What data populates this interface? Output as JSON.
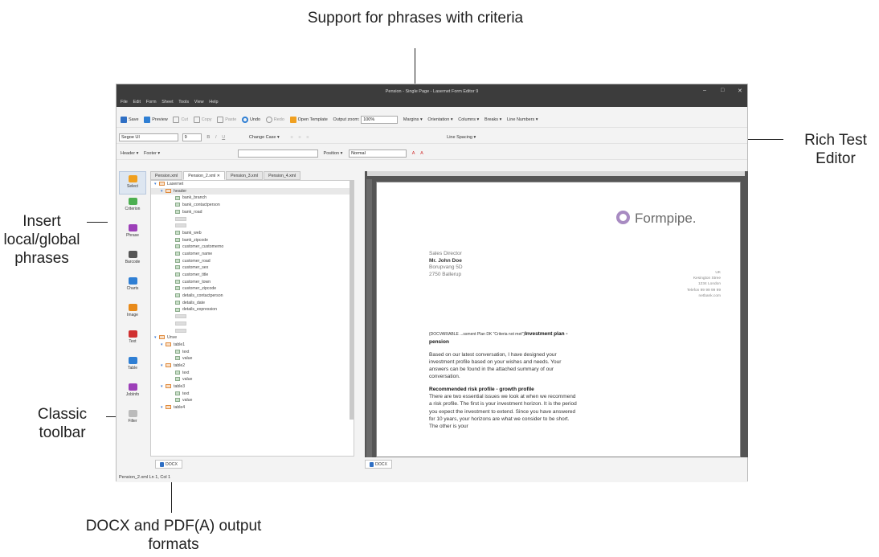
{
  "callouts": {
    "top": "Support for phrases with criteria",
    "right": "Rich Test Editor",
    "left1": "Insert local/global phrases",
    "left2": "Classic toolbar",
    "bottom": "DOCX and PDF(A) output formats"
  },
  "window": {
    "title": "Pension - Single Page - Lasernet Form Editor 9",
    "controls": [
      "–",
      "□",
      "✕"
    ]
  },
  "menu": [
    "File",
    "Edit",
    "Form",
    "Sheet",
    "Tools",
    "View",
    "Help"
  ],
  "toolbar1": {
    "save": "Save",
    "preview": "Preview",
    "cut": "Cut",
    "copy": "Copy",
    "paste": "Paste",
    "undo": "Undo",
    "redo": "Redo",
    "open_template": "Open Template",
    "output_zoom_label": "Output zoom:",
    "output_zoom_value": "100%",
    "margins": "Margins ▾",
    "orientation": "Orientation ▾",
    "columns": "Columns ▾",
    "breaks": "Breaks ▾",
    "line_numbers": "Line Numbers ▾"
  },
  "toolbar2": {
    "font": "Segoe UI",
    "size": "9",
    "change_case": "Change Case ▾",
    "line_spacing": "Line Spacing ▾"
  },
  "toolbar3": {
    "header": "Header ▾",
    "footer": "Footer ▾",
    "position": "Position ▾",
    "style": "Normal"
  },
  "sidebar": [
    {
      "label": "Select",
      "icon": "select-icon",
      "color": "#f0a020"
    },
    {
      "label": "Criterion",
      "icon": "criterion-icon",
      "color": "#4caf50"
    },
    {
      "label": "Phrase",
      "icon": "phrase-icon",
      "color": "#9c3fb8"
    },
    {
      "label": "Barcode",
      "icon": "barcode-icon",
      "color": "#555555"
    },
    {
      "label": "Charts",
      "icon": "charts-icon",
      "color": "#2f7fd4"
    },
    {
      "label": "Image",
      "icon": "image-icon",
      "color": "#e88a1a"
    },
    {
      "label": "Text",
      "icon": "text-icon",
      "color": "#d03030"
    },
    {
      "label": "Table",
      "icon": "table-icon",
      "color": "#2f7fd4"
    },
    {
      "label": "JobInfo",
      "icon": "jobinfo-icon",
      "color": "#9c3fb8"
    },
    {
      "label": "Filter",
      "icon": "filter-icon",
      "color": "#bbbbbb"
    }
  ],
  "tabs": [
    "Pension.xml",
    "Pension_2.xml ✕",
    "Pension_3.xml",
    "Pension_4.xml"
  ],
  "tree": [
    {
      "label": "Lasernet",
      "level": 0,
      "kind": "table"
    },
    {
      "label": "header",
      "level": 1,
      "kind": "table"
    },
    {
      "label": "bank_branch",
      "level": 2,
      "kind": "item"
    },
    {
      "label": "bank_contactperson",
      "level": 2,
      "kind": "item"
    },
    {
      "label": "bank_road",
      "level": 2,
      "kind": "item"
    },
    {
      "label": "",
      "level": 2,
      "kind": "blank"
    },
    {
      "label": "",
      "level": 2,
      "kind": "blank"
    },
    {
      "label": "bank_web",
      "level": 2,
      "kind": "item"
    },
    {
      "label": "bank_zipcode",
      "level": 2,
      "kind": "item"
    },
    {
      "label": "customer_customerno",
      "level": 2,
      "kind": "item"
    },
    {
      "label": "customer_name",
      "level": 2,
      "kind": "item"
    },
    {
      "label": "customer_road",
      "level": 2,
      "kind": "item"
    },
    {
      "label": "customer_sex",
      "level": 2,
      "kind": "item"
    },
    {
      "label": "customer_title",
      "level": 2,
      "kind": "item"
    },
    {
      "label": "customer_town",
      "level": 2,
      "kind": "item"
    },
    {
      "label": "customer_zipcode",
      "level": 2,
      "kind": "item"
    },
    {
      "label": "details_contactperson",
      "level": 2,
      "kind": "item"
    },
    {
      "label": "details_date",
      "level": 2,
      "kind": "item"
    },
    {
      "label": "details_expression",
      "level": 2,
      "kind": "item"
    },
    {
      "label": "",
      "level": 2,
      "kind": "blank"
    },
    {
      "label": "",
      "level": 2,
      "kind": "blank"
    },
    {
      "label": "",
      "level": 2,
      "kind": "blank"
    },
    {
      "label": "Unve",
      "level": 0,
      "kind": "table"
    },
    {
      "label": "table1",
      "level": 1,
      "kind": "table"
    },
    {
      "label": "text",
      "level": 2,
      "kind": "item"
    },
    {
      "label": "value",
      "level": 2,
      "kind": "item"
    },
    {
      "label": "table2",
      "level": 1,
      "kind": "table"
    },
    {
      "label": "text",
      "level": 2,
      "kind": "item"
    },
    {
      "label": "value",
      "level": 2,
      "kind": "item"
    },
    {
      "label": "table3",
      "level": 1,
      "kind": "table"
    },
    {
      "label": "text",
      "level": 2,
      "kind": "item"
    },
    {
      "label": "value",
      "level": 2,
      "kind": "item"
    },
    {
      "label": "table4",
      "level": 1,
      "kind": "table"
    }
  ],
  "left_bottom_tab": "DOCX",
  "right_bottom_tab": "DOCX",
  "status": "Pension_2.xml   Ln 1, Col 1",
  "document": {
    "logo": "Formpipe.",
    "sender": [
      "Sales Director",
      "Mr. John Doe",
      "Borupvang 5D",
      "2750 Ballerup"
    ],
    "recipient": [
      "UK",
      "Kesington Stree",
      "1234 London",
      "Telefon 99 99 99 99",
      "netbank.com"
    ],
    "field": "{DOCVARIABLE ...ssment Plan DK \"Criteria not met\"}",
    "heading": "Investment plan - pension",
    "para1": "Based on our latest conversation, I have designed your investment profile based on your wishes and needs. Your answers can be found in the attached summary of our conversation.",
    "subheading": "Recommended risk profile - growth profile",
    "para2": "There are two essential issues we look at when we recommend a risk profile. The first is your investment horizon. It is the period you expect the investment to extend. Since you have answered for 10 years, your horizons are what we consider to be short. The other is your"
  }
}
